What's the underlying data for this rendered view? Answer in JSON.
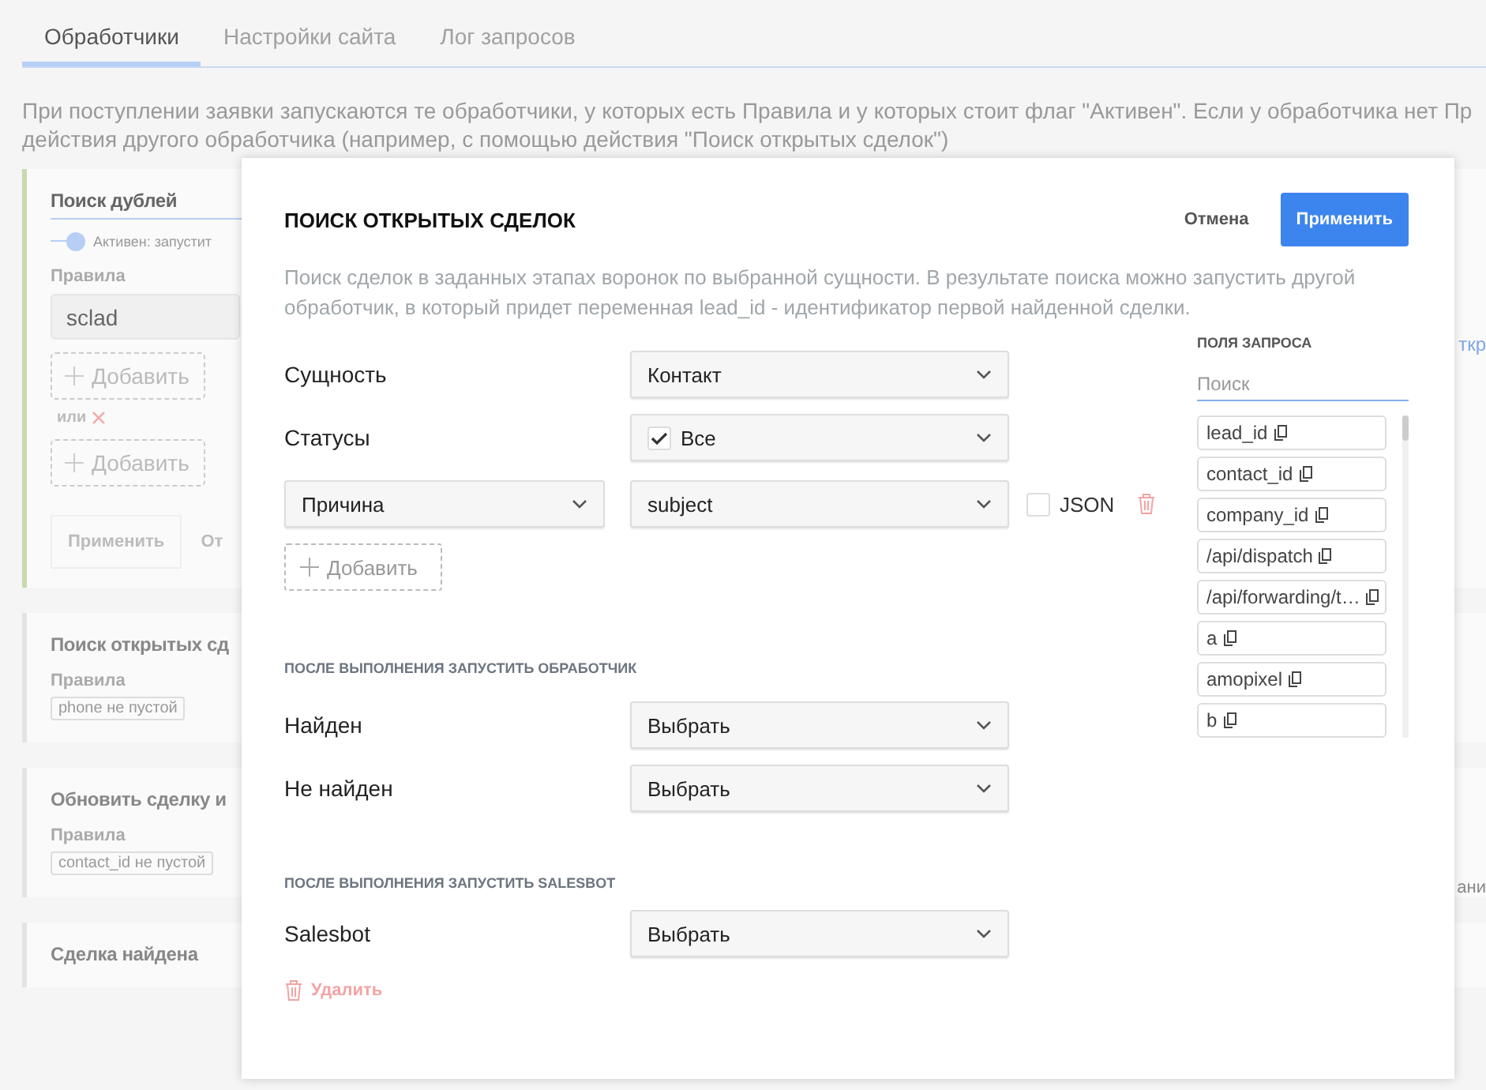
{
  "tabs": [
    {
      "label": "Обработчики",
      "selected": true
    },
    {
      "label": "Настройки сайта",
      "selected": false
    },
    {
      "label": "Лог запросов",
      "selected": false
    }
  ],
  "intro_lines": [
    "При поступлении заявки запускаются те обработчики, у которых есть Правила и у которых стоит флаг \"Активен\". Если у обработчика нет Пр",
    "действия другого обработчика (например, с помощью действия \"Поиск открытых сделок\")"
  ],
  "handlers": [
    {
      "title": "Поиск дублей",
      "expanded": true,
      "active": {
        "on": true,
        "label": "Активен: запустит"
      },
      "rules_label": "Правила",
      "rule_value": "sclad",
      "add_labels": [
        "Добавить",
        "Добавить"
      ],
      "or_label": "или",
      "apply": "Применить",
      "cancel": "От",
      "side_text": "ткр"
    },
    {
      "title": "Поиск открытых сд",
      "expanded": false,
      "rules_label": "Правила",
      "rule_tag": "phone не пустой"
    },
    {
      "title": "Обновить сделку и",
      "expanded": false,
      "rules_label": "Правила",
      "rule_tag": "contact_id не пустой",
      "side_text": "ани"
    },
    {
      "title": "Сделка найдена",
      "expanded": false
    }
  ],
  "modal": {
    "title": "ПОИСК ОТКРЫТЫХ СДЕЛОК",
    "cancel": "Отмена",
    "apply": "Применить",
    "description": "Поиск сделок в заданных этапах воронок по выбранной сущности. В результате поиска можно запустить другой обработчик, в который придет переменная lead_id - идентификатор первой найденной сделки.",
    "fields": [
      {
        "label": "Сущность",
        "value": "Контакт",
        "kind": "select"
      },
      {
        "label": "Статусы",
        "value": "Все",
        "kind": "check-select",
        "checked": true
      }
    ],
    "mapping": {
      "left": "Причина",
      "right": "subject",
      "json_label": "JSON",
      "json_checked": false
    },
    "add_label": "Добавить",
    "sections": [
      {
        "heading": "ПОСЛЕ ВЫПОЛНЕНИЯ ЗАПУСТИТЬ ОБРАБОТЧИК",
        "rows": [
          {
            "label": "Найден",
            "value": "Выбрать"
          },
          {
            "label": "Не найден",
            "value": "Выбрать"
          }
        ]
      },
      {
        "heading": "ПОСЛЕ ВЫПОЛНЕНИЯ ЗАПУСТИТЬ SALESBOT",
        "rows": [
          {
            "label": "Salesbot",
            "value": "Выбрать"
          }
        ]
      }
    ],
    "delete_label": "Удалить",
    "query_fields": {
      "heading": "ПОЛЯ ЗАПРОСА",
      "search_placeholder": "Поиск",
      "items": [
        "lead_id",
        "contact_id",
        "company_id",
        "/api/dispatch",
        "/api/forwarding/t…",
        "a",
        "amopixel",
        "b"
      ]
    }
  }
}
